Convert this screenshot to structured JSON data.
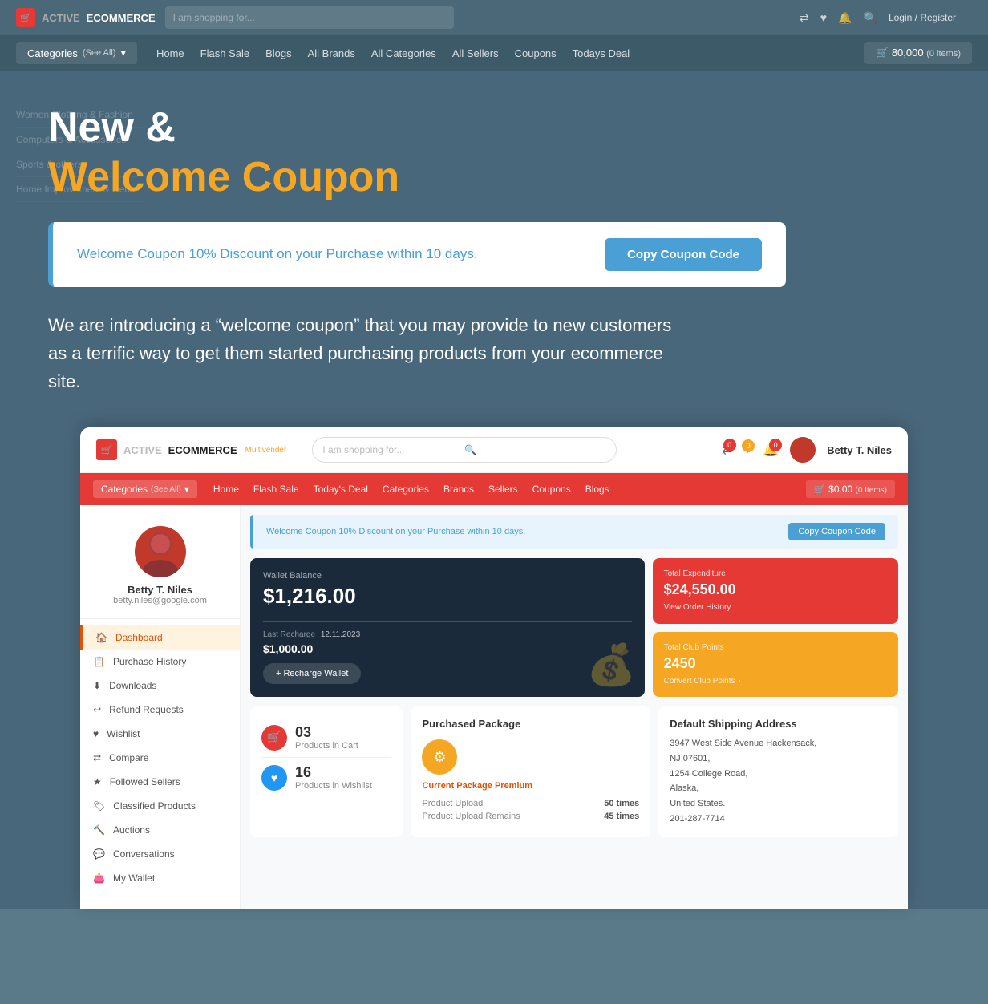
{
  "app": {
    "name_active": "ACTIVE",
    "name_ec": "ECOMMERCE",
    "tagline": "Multivender"
  },
  "topnav": {
    "search_placeholder": "I am shopping for...",
    "icons": [
      "compare",
      "wishlist",
      "notifications",
      "search",
      "user"
    ],
    "user_label": "Login / Register"
  },
  "catnav": {
    "categories_label": "Categories",
    "see_all": "(See All)",
    "links": [
      "Home",
      "Flash Sale",
      "Blogs",
      "All Brands",
      "All Categories",
      "All Sellers",
      "Coupons",
      "Todays Deal"
    ],
    "cart_label": "80,000",
    "cart_items": "(0 items)"
  },
  "hero": {
    "line1": "New &",
    "line2": "Welcome Coupon",
    "coupon_text": "Welcome Coupon 10% Discount on your Purchase within 10 days.",
    "copy_btn": "Copy Coupon Code",
    "description": "We are introducing a “welcome coupon” that you may provide to new customers as a terrific way to get them started purchasing products from your ecommerce site."
  },
  "sidebar_ghost": {
    "items": [
      "Women Clothing & Fashion",
      "Computers & Accessories",
      "Sports & others",
      "Home Improvement & Deco"
    ]
  },
  "dashboard": {
    "topbar": {
      "logo_active": "ACTIVE",
      "logo_ec": "ECOMMERCE",
      "search_placeholder": "I am shopping for...",
      "icons": [
        "compare",
        "wishlist",
        "notifications"
      ],
      "username": "Betty T. Niles"
    },
    "catbar": {
      "categories_label": "Categories",
      "see_all": "(See All)",
      "links": [
        "Home",
        "Flash Sale",
        "Today's Deal",
        "Categories",
        "Brands",
        "Sellers",
        "Coupons",
        "Blogs"
      ],
      "cart_label": "$0.00",
      "cart_items": "(0 Items)"
    },
    "sidebar": {
      "user_name": "Betty T. Niles",
      "user_email": "betty.niles@google.com",
      "menu_items": [
        {
          "label": "Dashboard",
          "icon": "home",
          "active": true
        },
        {
          "label": "Purchase History",
          "icon": "list"
        },
        {
          "label": "Downloads",
          "icon": "download"
        },
        {
          "label": "Refund Requests",
          "icon": "refresh"
        },
        {
          "label": "Wishlist",
          "icon": "heart"
        },
        {
          "label": "Compare",
          "icon": "compare"
        },
        {
          "label": "Followed Sellers",
          "icon": "star"
        },
        {
          "label": "Classified Products",
          "icon": "tag"
        },
        {
          "label": "Auctions",
          "icon": "gavel"
        },
        {
          "label": "Conversations",
          "icon": "chat"
        },
        {
          "label": "My Wallet",
          "icon": "wallet"
        }
      ]
    },
    "coupon_bar": {
      "text": "Welcome Coupon 10% Discount on your Purchase within 10 days.",
      "btn_label": "Copy Coupon Code"
    },
    "wallet": {
      "label": "Wallet Balance",
      "amount": "$1,216.00",
      "recharge_label": "Last Recharge",
      "recharge_date": "12.11.2023",
      "recharge_amount": "$1,000.00",
      "recharge_btn": "+ Recharge Wallet"
    },
    "total_expenditure": {
      "label": "Total Expenditure",
      "amount": "$24,550.00",
      "link": "View Order History"
    },
    "total_club_points": {
      "label": "Total Club Points",
      "amount": "2450",
      "link": "Convert Club Points"
    },
    "cart_count": {
      "value": "03",
      "label": "Products in Cart"
    },
    "wishlist_count": {
      "value": "16",
      "label": "Products in Wishlist"
    },
    "package": {
      "title": "Purchased Package",
      "type": "Current Package Premium",
      "rows": [
        {
          "label": "Product Upload",
          "value": "50 times"
        },
        {
          "label": "Product Upload Remains",
          "value": "45 times"
        }
      ]
    },
    "address": {
      "title": "Default Shipping Address",
      "line1": "3947 West Side Avenue Hackensack,",
      "line2": "NJ 07601,",
      "line3": "1254 College Road,",
      "line4": "Alaska,",
      "line5": "United States.",
      "phone": "201-287-7714"
    }
  }
}
